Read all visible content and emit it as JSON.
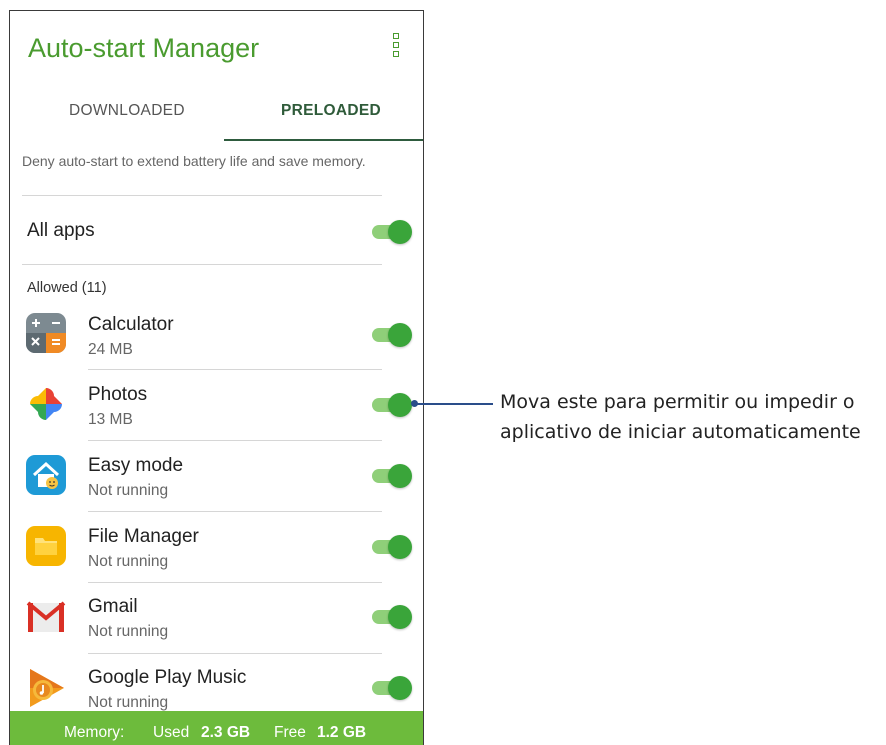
{
  "app": {
    "title": "Auto-start Manager",
    "menu_icon": "more-vert-icon"
  },
  "tabs": [
    {
      "label": "DOWNLOADED",
      "active": false
    },
    {
      "label": "PRELOADED",
      "active": true
    }
  ],
  "description": "Deny auto-start to extend battery life and save memory.",
  "all_apps": {
    "label": "All apps",
    "enabled": true
  },
  "section_label": "Allowed (11)",
  "apps": [
    {
      "name": "Calculator",
      "sub": "24 MB",
      "icon": "calculator-icon",
      "enabled": true
    },
    {
      "name": "Photos",
      "sub": "13 MB",
      "icon": "photos-icon",
      "enabled": true
    },
    {
      "name": "Easy mode",
      "sub": "Not running",
      "icon": "easy-mode-icon",
      "enabled": true
    },
    {
      "name": "File Manager",
      "sub": "Not running",
      "icon": "file-manager-icon",
      "enabled": true
    },
    {
      "name": "Gmail",
      "sub": "Not running",
      "icon": "gmail-icon",
      "enabled": true
    },
    {
      "name": "Google Play Music",
      "sub": "Not running",
      "icon": "play-music-icon",
      "enabled": true
    }
  ],
  "footer": {
    "memory_label": "Memory:",
    "used_label": "Used",
    "used_value": "2.3 GB",
    "free_label": "Free",
    "free_value": "1.2 GB"
  },
  "annotation": {
    "line1": "Mova este para permitir ou impedir o",
    "line2": "aplicativo de iniciar automaticamente"
  },
  "colors": {
    "accent": "#4a9b2f",
    "toggle_on": "#3aa53a",
    "footer_bg": "#6dbb3c",
    "tab_active": "#2e5b3e",
    "connector": "#2a4d8a"
  }
}
